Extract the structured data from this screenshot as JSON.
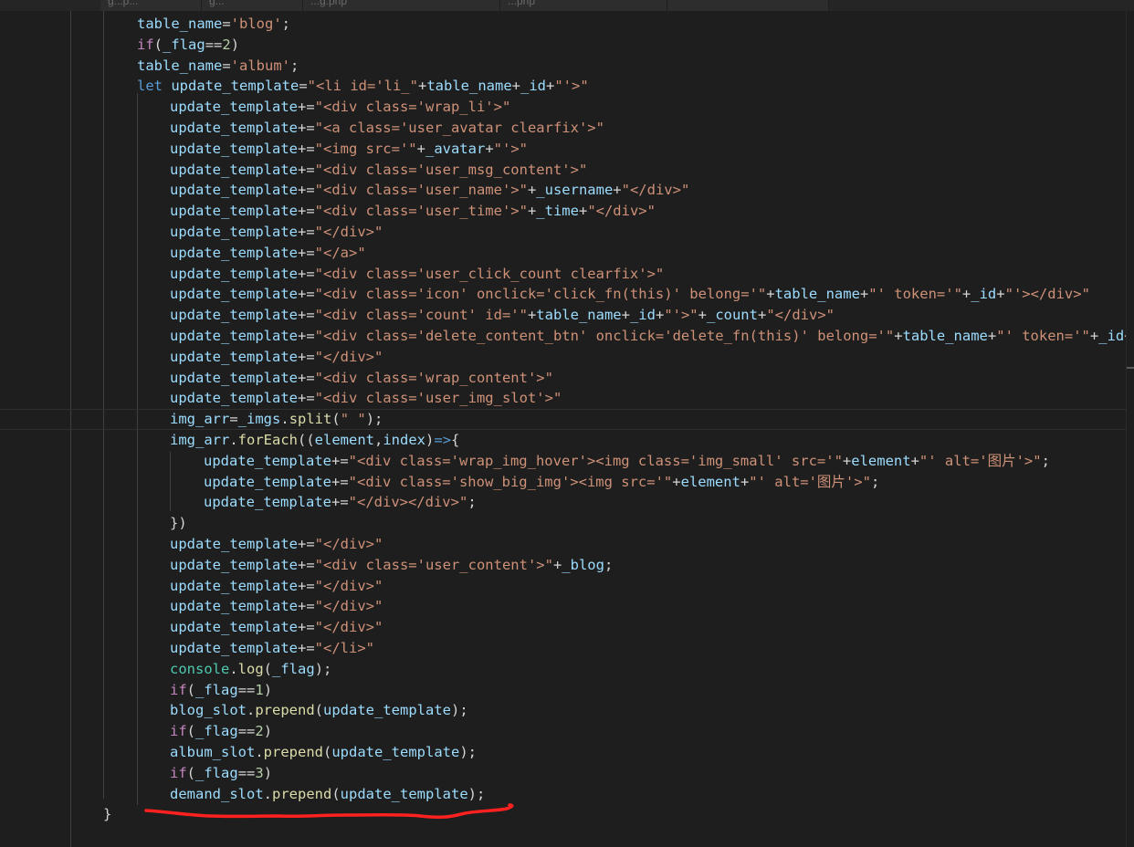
{
  "tabs": [
    {
      "label": "g...p..."
    },
    {
      "label": "g..."
    },
    {
      "label": "...g.php"
    },
    {
      "label": "...php"
    },
    {
      "label": ""
    }
  ],
  "code_lines": [
    {
      "indent": 150,
      "tokens": [
        {
          "t": "v",
          "x": "table_name"
        },
        {
          "t": "p",
          "x": "="
        },
        {
          "t": "s",
          "x": "'blog'"
        },
        {
          "t": "p",
          "x": ";"
        }
      ]
    },
    {
      "indent": 150,
      "tokens": [
        {
          "t": "k",
          "x": "if"
        },
        {
          "t": "p",
          "x": "("
        },
        {
          "t": "v",
          "x": "_flag"
        },
        {
          "t": "p",
          "x": "=="
        },
        {
          "t": "n",
          "x": "2"
        },
        {
          "t": "p",
          "x": ")"
        }
      ]
    },
    {
      "indent": 150,
      "tokens": [
        {
          "t": "v",
          "x": "table_name"
        },
        {
          "t": "p",
          "x": "="
        },
        {
          "t": "s",
          "x": "'album'"
        },
        {
          "t": "p",
          "x": ";"
        }
      ]
    },
    {
      "indent": 150,
      "tokens": [
        {
          "t": "kb",
          "x": "let "
        },
        {
          "t": "v",
          "x": "update_template"
        },
        {
          "t": "p",
          "x": "="
        },
        {
          "t": "s",
          "x": "\"<li id='li_\""
        },
        {
          "t": "p",
          "x": "+"
        },
        {
          "t": "v",
          "x": "table_name"
        },
        {
          "t": "p",
          "x": "+"
        },
        {
          "t": "v",
          "x": "_id"
        },
        {
          "t": "p",
          "x": "+"
        },
        {
          "t": "s",
          "x": "\"'>\""
        }
      ]
    },
    {
      "indent": 186,
      "tokens": [
        {
          "t": "v",
          "x": "update_template"
        },
        {
          "t": "p",
          "x": "+="
        },
        {
          "t": "s",
          "x": "\"<div class='wrap_li'>\""
        }
      ]
    },
    {
      "indent": 186,
      "tokens": [
        {
          "t": "v",
          "x": "update_template"
        },
        {
          "t": "p",
          "x": "+="
        },
        {
          "t": "s",
          "x": "\"<a class='user_avatar clearfix'>\""
        }
      ]
    },
    {
      "indent": 186,
      "tokens": [
        {
          "t": "v",
          "x": "update_template"
        },
        {
          "t": "p",
          "x": "+="
        },
        {
          "t": "s",
          "x": "\"<img src='\""
        },
        {
          "t": "p",
          "x": "+"
        },
        {
          "t": "v",
          "x": "_avatar"
        },
        {
          "t": "p",
          "x": "+"
        },
        {
          "t": "s",
          "x": "\"'>\""
        }
      ]
    },
    {
      "indent": 186,
      "tokens": [
        {
          "t": "v",
          "x": "update_template"
        },
        {
          "t": "p",
          "x": "+="
        },
        {
          "t": "s",
          "x": "\"<div class='user_msg_content'>\""
        }
      ]
    },
    {
      "indent": 186,
      "tokens": [
        {
          "t": "v",
          "x": "update_template"
        },
        {
          "t": "p",
          "x": "+="
        },
        {
          "t": "s",
          "x": "\"<div class='user_name'>\""
        },
        {
          "t": "p",
          "x": "+"
        },
        {
          "t": "v",
          "x": "_username"
        },
        {
          "t": "p",
          "x": "+"
        },
        {
          "t": "s",
          "x": "\"</div>\""
        }
      ]
    },
    {
      "indent": 186,
      "tokens": [
        {
          "t": "v",
          "x": "update_template"
        },
        {
          "t": "p",
          "x": "+="
        },
        {
          "t": "s",
          "x": "\"<div class='user_time'>\""
        },
        {
          "t": "p",
          "x": "+"
        },
        {
          "t": "v",
          "x": "_time"
        },
        {
          "t": "p",
          "x": "+"
        },
        {
          "t": "s",
          "x": "\"</div>\""
        }
      ]
    },
    {
      "indent": 186,
      "tokens": [
        {
          "t": "v",
          "x": "update_template"
        },
        {
          "t": "p",
          "x": "+="
        },
        {
          "t": "s",
          "x": "\"</div>\""
        }
      ]
    },
    {
      "indent": 186,
      "tokens": [
        {
          "t": "v",
          "x": "update_template"
        },
        {
          "t": "p",
          "x": "+="
        },
        {
          "t": "s",
          "x": "\"</a>\""
        }
      ]
    },
    {
      "indent": 186,
      "tokens": [
        {
          "t": "v",
          "x": "update_template"
        },
        {
          "t": "p",
          "x": "+="
        },
        {
          "t": "s",
          "x": "\"<div class='user_click_count clearfix'>\""
        }
      ]
    },
    {
      "indent": 186,
      "tokens": [
        {
          "t": "v",
          "x": "update_template"
        },
        {
          "t": "p",
          "x": "+="
        },
        {
          "t": "s",
          "x": "\"<div class='icon' onclick='click_fn(this)' belong='\""
        },
        {
          "t": "p",
          "x": "+"
        },
        {
          "t": "v",
          "x": "table_name"
        },
        {
          "t": "p",
          "x": "+"
        },
        {
          "t": "s",
          "x": "\"' token='\""
        },
        {
          "t": "p",
          "x": "+"
        },
        {
          "t": "v",
          "x": "_id"
        },
        {
          "t": "p",
          "x": "+"
        },
        {
          "t": "s",
          "x": "\"'></div>\""
        }
      ]
    },
    {
      "indent": 186,
      "tokens": [
        {
          "t": "v",
          "x": "update_template"
        },
        {
          "t": "p",
          "x": "+="
        },
        {
          "t": "s",
          "x": "\"<div class='count' id='\""
        },
        {
          "t": "p",
          "x": "+"
        },
        {
          "t": "v",
          "x": "table_name"
        },
        {
          "t": "p",
          "x": "+"
        },
        {
          "t": "v",
          "x": "_id"
        },
        {
          "t": "p",
          "x": "+"
        },
        {
          "t": "s",
          "x": "\"'>\""
        },
        {
          "t": "p",
          "x": "+"
        },
        {
          "t": "v",
          "x": "_count"
        },
        {
          "t": "p",
          "x": "+"
        },
        {
          "t": "s",
          "x": "\"</div>\""
        }
      ]
    },
    {
      "indent": 186,
      "tokens": [
        {
          "t": "v",
          "x": "update_template"
        },
        {
          "t": "p",
          "x": "+="
        },
        {
          "t": "s",
          "x": "\"<div class='delete_content_btn' onclick='delete_fn(this)' belong='\""
        },
        {
          "t": "p",
          "x": "+"
        },
        {
          "t": "v",
          "x": "table_name"
        },
        {
          "t": "p",
          "x": "+"
        },
        {
          "t": "s",
          "x": "\"' token='\""
        },
        {
          "t": "p",
          "x": "+"
        },
        {
          "t": "v",
          "x": "_id"
        },
        {
          "t": "p",
          "x": "+"
        },
        {
          "t": "s",
          "x": "'"
        }
      ]
    },
    {
      "indent": 186,
      "tokens": [
        {
          "t": "v",
          "x": "update_template"
        },
        {
          "t": "p",
          "x": "+="
        },
        {
          "t": "s",
          "x": "\"</div>\""
        }
      ]
    },
    {
      "indent": 186,
      "tokens": [
        {
          "t": "v",
          "x": "update_template"
        },
        {
          "t": "p",
          "x": "+="
        },
        {
          "t": "s",
          "x": "\"<div class='wrap_content'>\""
        }
      ]
    },
    {
      "indent": 186,
      "tokens": [
        {
          "t": "v",
          "x": "update_template"
        },
        {
          "t": "p",
          "x": "+="
        },
        {
          "t": "s",
          "x": "\"<div class='user_img_slot'>\""
        }
      ]
    },
    {
      "indent": 186,
      "tokens": [
        {
          "t": "v",
          "x": "img_arr"
        },
        {
          "t": "p",
          "x": "="
        },
        {
          "t": "v",
          "x": "_imgs"
        },
        {
          "t": "p",
          "x": "."
        },
        {
          "t": "f",
          "x": "split"
        },
        {
          "t": "p",
          "x": "("
        },
        {
          "t": "s",
          "x": "\" \""
        },
        {
          "t": "p",
          "x": ");"
        }
      ]
    },
    {
      "indent": 186,
      "tokens": [
        {
          "t": "v",
          "x": "img_arr"
        },
        {
          "t": "p",
          "x": "."
        },
        {
          "t": "f",
          "x": "forEach"
        },
        {
          "t": "p",
          "x": "(("
        },
        {
          "t": "v",
          "x": "element"
        },
        {
          "t": "p",
          "x": ","
        },
        {
          "t": "v",
          "x": "index"
        },
        {
          "t": "p",
          "x": ")"
        },
        {
          "t": "kb",
          "x": "=>"
        },
        {
          "t": "p",
          "x": "{"
        }
      ]
    },
    {
      "indent": 223,
      "tokens": [
        {
          "t": "v",
          "x": "update_template"
        },
        {
          "t": "p",
          "x": "+="
        },
        {
          "t": "s",
          "x": "\"<div class='wrap_img_hover'><img class='img_small' src='\""
        },
        {
          "t": "p",
          "x": "+"
        },
        {
          "t": "v",
          "x": "element"
        },
        {
          "t": "p",
          "x": "+"
        },
        {
          "t": "s",
          "x": "\"' alt='图片'>\""
        },
        {
          "t": "p",
          "x": ";"
        }
      ]
    },
    {
      "indent": 223,
      "tokens": [
        {
          "t": "v",
          "x": "update_template"
        },
        {
          "t": "p",
          "x": "+="
        },
        {
          "t": "s",
          "x": "\"<div class='show_big_img'><img src='\""
        },
        {
          "t": "p",
          "x": "+"
        },
        {
          "t": "v",
          "x": "element"
        },
        {
          "t": "p",
          "x": "+"
        },
        {
          "t": "s",
          "x": "\"' alt='图片'>\""
        },
        {
          "t": "p",
          "x": ";"
        }
      ]
    },
    {
      "indent": 223,
      "tokens": [
        {
          "t": "v",
          "x": "update_template"
        },
        {
          "t": "p",
          "x": "+="
        },
        {
          "t": "s",
          "x": "\"</div></div>\""
        },
        {
          "t": "p",
          "x": ";"
        }
      ]
    },
    {
      "indent": 186,
      "tokens": [
        {
          "t": "p",
          "x": "})"
        }
      ]
    },
    {
      "indent": 186,
      "tokens": [
        {
          "t": "v",
          "x": "update_template"
        },
        {
          "t": "p",
          "x": "+="
        },
        {
          "t": "s",
          "x": "\"</div>\""
        }
      ]
    },
    {
      "indent": 186,
      "tokens": [
        {
          "t": "v",
          "x": "update_template"
        },
        {
          "t": "p",
          "x": "+="
        },
        {
          "t": "s",
          "x": "\"<div class='user_content'>\""
        },
        {
          "t": "p",
          "x": "+"
        },
        {
          "t": "v",
          "x": "_blog"
        },
        {
          "t": "p",
          "x": ";"
        }
      ]
    },
    {
      "indent": 186,
      "tokens": [
        {
          "t": "v",
          "x": "update_template"
        },
        {
          "t": "p",
          "x": "+="
        },
        {
          "t": "s",
          "x": "\"</div>\""
        }
      ]
    },
    {
      "indent": 186,
      "tokens": [
        {
          "t": "v",
          "x": "update_template"
        },
        {
          "t": "p",
          "x": "+="
        },
        {
          "t": "s",
          "x": "\"</div>\""
        }
      ]
    },
    {
      "indent": 186,
      "tokens": [
        {
          "t": "v",
          "x": "update_template"
        },
        {
          "t": "p",
          "x": "+="
        },
        {
          "t": "s",
          "x": "\"</div>\""
        }
      ]
    },
    {
      "indent": 186,
      "tokens": [
        {
          "t": "v",
          "x": "update_template"
        },
        {
          "t": "p",
          "x": "+="
        },
        {
          "t": "s",
          "x": "\"</li>\""
        }
      ]
    },
    {
      "indent": 186,
      "tokens": [
        {
          "t": "c",
          "x": "console"
        },
        {
          "t": "p",
          "x": "."
        },
        {
          "t": "f",
          "x": "log"
        },
        {
          "t": "p",
          "x": "("
        },
        {
          "t": "v",
          "x": "_flag"
        },
        {
          "t": "p",
          "x": ");"
        }
      ]
    },
    {
      "indent": 186,
      "tokens": [
        {
          "t": "k",
          "x": "if"
        },
        {
          "t": "p",
          "x": "("
        },
        {
          "t": "v",
          "x": "_flag"
        },
        {
          "t": "p",
          "x": "=="
        },
        {
          "t": "n",
          "x": "1"
        },
        {
          "t": "p",
          "x": ")"
        }
      ]
    },
    {
      "indent": 186,
      "tokens": [
        {
          "t": "v",
          "x": "blog_slot"
        },
        {
          "t": "p",
          "x": "."
        },
        {
          "t": "f",
          "x": "prepend"
        },
        {
          "t": "p",
          "x": "("
        },
        {
          "t": "v",
          "x": "update_template"
        },
        {
          "t": "p",
          "x": ");"
        }
      ]
    },
    {
      "indent": 186,
      "tokens": [
        {
          "t": "k",
          "x": "if"
        },
        {
          "t": "p",
          "x": "("
        },
        {
          "t": "v",
          "x": "_flag"
        },
        {
          "t": "p",
          "x": "=="
        },
        {
          "t": "n",
          "x": "2"
        },
        {
          "t": "p",
          "x": ")"
        }
      ]
    },
    {
      "indent": 186,
      "tokens": [
        {
          "t": "v",
          "x": "album_slot"
        },
        {
          "t": "p",
          "x": "."
        },
        {
          "t": "f",
          "x": "prepend"
        },
        {
          "t": "p",
          "x": "("
        },
        {
          "t": "v",
          "x": "update_template"
        },
        {
          "t": "p",
          "x": ");"
        }
      ]
    },
    {
      "indent": 186,
      "tokens": [
        {
          "t": "k",
          "x": "if"
        },
        {
          "t": "p",
          "x": "("
        },
        {
          "t": "v",
          "x": "_flag"
        },
        {
          "t": "p",
          "x": "=="
        },
        {
          "t": "n",
          "x": "3"
        },
        {
          "t": "p",
          "x": ")"
        }
      ]
    },
    {
      "indent": 186,
      "tokens": [
        {
          "t": "v",
          "x": "demand_slot"
        },
        {
          "t": "p",
          "x": "."
        },
        {
          "t": "f",
          "x": "prepend"
        },
        {
          "t": "p",
          "x": "("
        },
        {
          "t": "v",
          "x": "update_template"
        },
        {
          "t": "p",
          "x": ");"
        }
      ]
    },
    {
      "indent": 113,
      "tokens": [
        {
          "t": "p",
          "x": "}"
        }
      ]
    }
  ],
  "annotation": {
    "color": "#ff2020"
  }
}
